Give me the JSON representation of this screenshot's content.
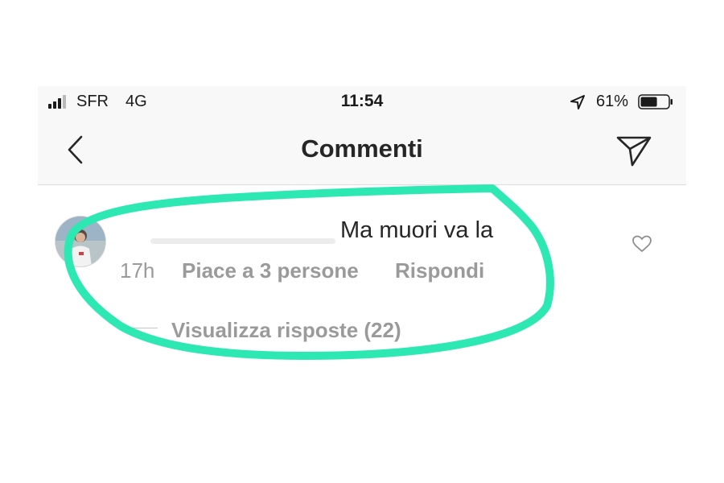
{
  "status_bar": {
    "carrier": "SFR",
    "network": "4G",
    "time": "11:54",
    "battery_percent": "61%",
    "battery_level": 0.61,
    "signal_bars_filled": 3,
    "signal_bars_total": 4
  },
  "navbar": {
    "title": "Commenti",
    "back_icon": "chevron-left-icon",
    "send_icon": "paper-plane-icon"
  },
  "comment": {
    "text": "Ma muori va la",
    "time": "17h",
    "likes": "Piace a 3 persone",
    "reply": "Rispondi",
    "view_replies": "Visualizza risposte (22)"
  },
  "colors": {
    "annotation_stroke": "#2ee8b3",
    "secondary_text": "#9a9a9a",
    "primary_text": "#262626",
    "header_bg": "#f8f8f8"
  }
}
